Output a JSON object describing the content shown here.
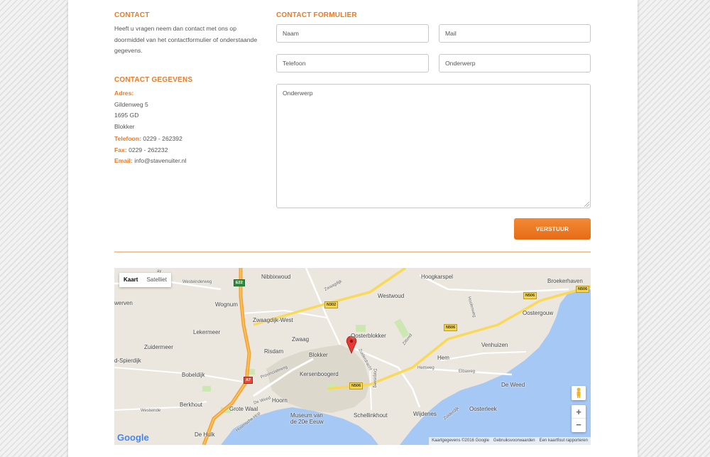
{
  "contact": {
    "heading": "CONTACT",
    "intro": "Heeft u vragen neem dan contact met ons op doormiddel van het contactformulier of onderstaande gegevens."
  },
  "gegevens": {
    "heading": "CONTACT GEGEVENS",
    "address_label": "Adres:",
    "street": "Gildenweg 5",
    "postcode": "1695 GD",
    "city": "Blokker",
    "phone_label": "Telefoon:",
    "phone": "0229 - 262392",
    "fax_label": "Fax:",
    "fax": "0229 - 262232",
    "email_label": "Email:",
    "email": "info@stavenuiter.nl"
  },
  "form": {
    "heading": "CONTACT FORMULIER",
    "name_placeholder": "Naam",
    "mail_placeholder": "Mail",
    "phone_placeholder": "Telefoon",
    "subject_placeholder": "Onderwerp",
    "message_placeholder": "Onderwerp",
    "submit_label": "VERSTUUR"
  },
  "map": {
    "type_map": "Kaart",
    "type_satellite": "Satelliet",
    "zoom_in": "+",
    "zoom_out": "−",
    "logo": "Google",
    "attribution": [
      "Kaartgegevens ©2016 Google",
      "Gebruiksvoorwaarden",
      "Een kaartfout rapporteren"
    ],
    "places": {
      "nibbixwoud": "Nibbixwoud",
      "hoogkarspel": "Hoogkarspel",
      "broekerhaven": "Broekerhaven",
      "westwoud": "Westwoud",
      "oostergouw": "Oostergouw",
      "wognum": "Wognum",
      "werven": "werven",
      "zwaagdijk": "Zwaagdijk-West",
      "lekermeer": "Lekermeer",
      "oosterblokker": "Oosterblokker",
      "zuidermeer": "Zuidermeer",
      "zwaag": "Zwaag",
      "risdam": "Risdam",
      "blokker": "Blokker",
      "venhuizen": "Venhuizen",
      "spierdijk": "d-Spierdijk",
      "bobeldijk": "Bobeldijk",
      "kersenboogerd": "Kersenboogerd",
      "hem": "Hem",
      "deweed": "De Weed",
      "berkhout": "Berkhout",
      "grotewaal": "Grote Waal",
      "hoorn": "Hoorn",
      "schellinkhout": "Schellinkhout",
      "wijdenes": "Wijdenes",
      "oosterleek": "Oosterleek",
      "museum": "Museum van de 20e Eeuw",
      "dehulk": "De Hulk"
    },
    "minor": {
      "westeinderweg": "Westeinderweg",
      "zwaagdijk_road": "Zwaagdijk",
      "provinciale": "Provincialeweg",
      "hoornsche": "Hoornsche Hop",
      "westeinde": "Westeinde",
      "deweed_road": "De Weed",
      "dorpsweg": "Dorpsweg",
      "zuiderdracht": "Zuiderdracht",
      "zittend": "Zittend",
      "hemweg": "Hemweg",
      "elbaweg": "Elbaweg",
      "zuiderdijk": "Zuiderdijk",
      "hoolenweg": "Hoolenweg",
      "gay": "ay"
    },
    "shields": {
      "e22": "E22",
      "n302": "N302",
      "n506a": "N506",
      "n506b": "N506",
      "n506c": "N506",
      "n506d": "N506",
      "a7": "A7"
    },
    "colors": {
      "land": "#ebe7de",
      "water": "#a6c8f5",
      "highway": "#f3a437",
      "road": "#ffffff",
      "yellow_road": "#fad959"
    }
  }
}
